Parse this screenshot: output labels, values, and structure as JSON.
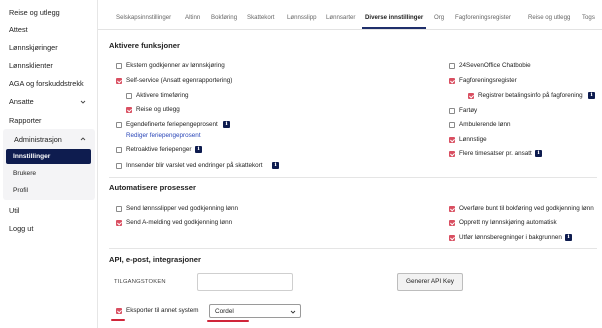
{
  "sidebar": {
    "items": [
      {
        "label": "Reise og utlegg"
      },
      {
        "label": "Attest"
      },
      {
        "label": "Lønnskjøringer"
      },
      {
        "label": "Lønnsklienter"
      },
      {
        "label": "AGA og forskuddstrekk"
      },
      {
        "label": "Ansatte"
      },
      {
        "label": "Rapporter"
      },
      {
        "label": "Administrasjon"
      },
      {
        "label": "Util"
      },
      {
        "label": "Logg ut"
      }
    ],
    "admin_sub": [
      {
        "label": "Innstillinger",
        "active": true
      },
      {
        "label": "Brukere"
      },
      {
        "label": "Profil"
      }
    ]
  },
  "tabs": [
    {
      "label": "Selskapsinnstillinger"
    },
    {
      "label": "Altinn"
    },
    {
      "label": "Bokføring"
    },
    {
      "label": "Skattekort"
    },
    {
      "label": "Lønnsslipp"
    },
    {
      "label": "Lønnsarter"
    },
    {
      "label": "Diverse innstillinger",
      "active": true
    },
    {
      "label": "Org"
    },
    {
      "label": "Fagforeningsregister"
    },
    {
      "label": "Reise og utlegg"
    },
    {
      "label": "Togs"
    }
  ],
  "sections": {
    "aktivere": {
      "title": "Aktivere funksjoner"
    },
    "automatisere": {
      "title": "Automatisere prosesser"
    },
    "api": {
      "title": "API, e-post, integrasjoner"
    }
  },
  "aktivere_left": [
    {
      "label": "Ekstern godkjenner av lønnskjøring",
      "checked": false
    },
    {
      "label": "Self-service (Ansatt egenrapportering)",
      "checked": true
    },
    {
      "label": "Aktivere timeføring",
      "checked": false
    },
    {
      "label": "Reise og utlegg",
      "checked": true
    },
    {
      "label": "Egendefinerte feriepengeprosent",
      "checked": false
    },
    {
      "label": "Rediger feriepengeprosent",
      "link": true
    },
    {
      "label": "Retroaktive feriepenger",
      "checked": false
    },
    {
      "label": "Innsender blir varslet ved endringer på skattekort",
      "checked": false
    }
  ],
  "aktivere_right": [
    {
      "label": "24SevenOffice Chatbobie",
      "checked": false
    },
    {
      "label": "Fagforeningsregister",
      "checked": true
    },
    {
      "label": "Registrer betalingsinfo på fagforening",
      "checked": true
    },
    {
      "label": "Fartøy",
      "checked": false
    },
    {
      "label": "Ambulerende lønn",
      "checked": false
    },
    {
      "label": "Lønnstige",
      "checked": true
    },
    {
      "label": "Flere timesatser pr. ansatt",
      "checked": true
    }
  ],
  "automatisere_left": [
    {
      "label": "Send lønnsslipper ved godkjenning lønn",
      "checked": false
    },
    {
      "label": "Send A-melding ved godkjenning lønn",
      "checked": true
    }
  ],
  "automatisere_right": [
    {
      "label": "Overføre bunt til bokføring ved godkjenning lønn",
      "checked": true
    },
    {
      "label": "Opprett ny lønnskjøring automatisk",
      "checked": true
    },
    {
      "label": "Utfør lønnsberegninger i bakgrunnen",
      "checked": true
    }
  ],
  "api": {
    "token_label": "TILGANGSTOKEN",
    "token_value": "",
    "generate_button": "Generer API Key",
    "export_label": "Eksporter til annet system",
    "export_checked": true,
    "export_system": "Cordel"
  },
  "icons": {
    "info": "i"
  },
  "colors": {
    "accent_navy": "#0e1c4f",
    "checkbox_red": "#d94f61",
    "highlight_red": "#d0263a",
    "link_blue": "#2a46b8"
  }
}
